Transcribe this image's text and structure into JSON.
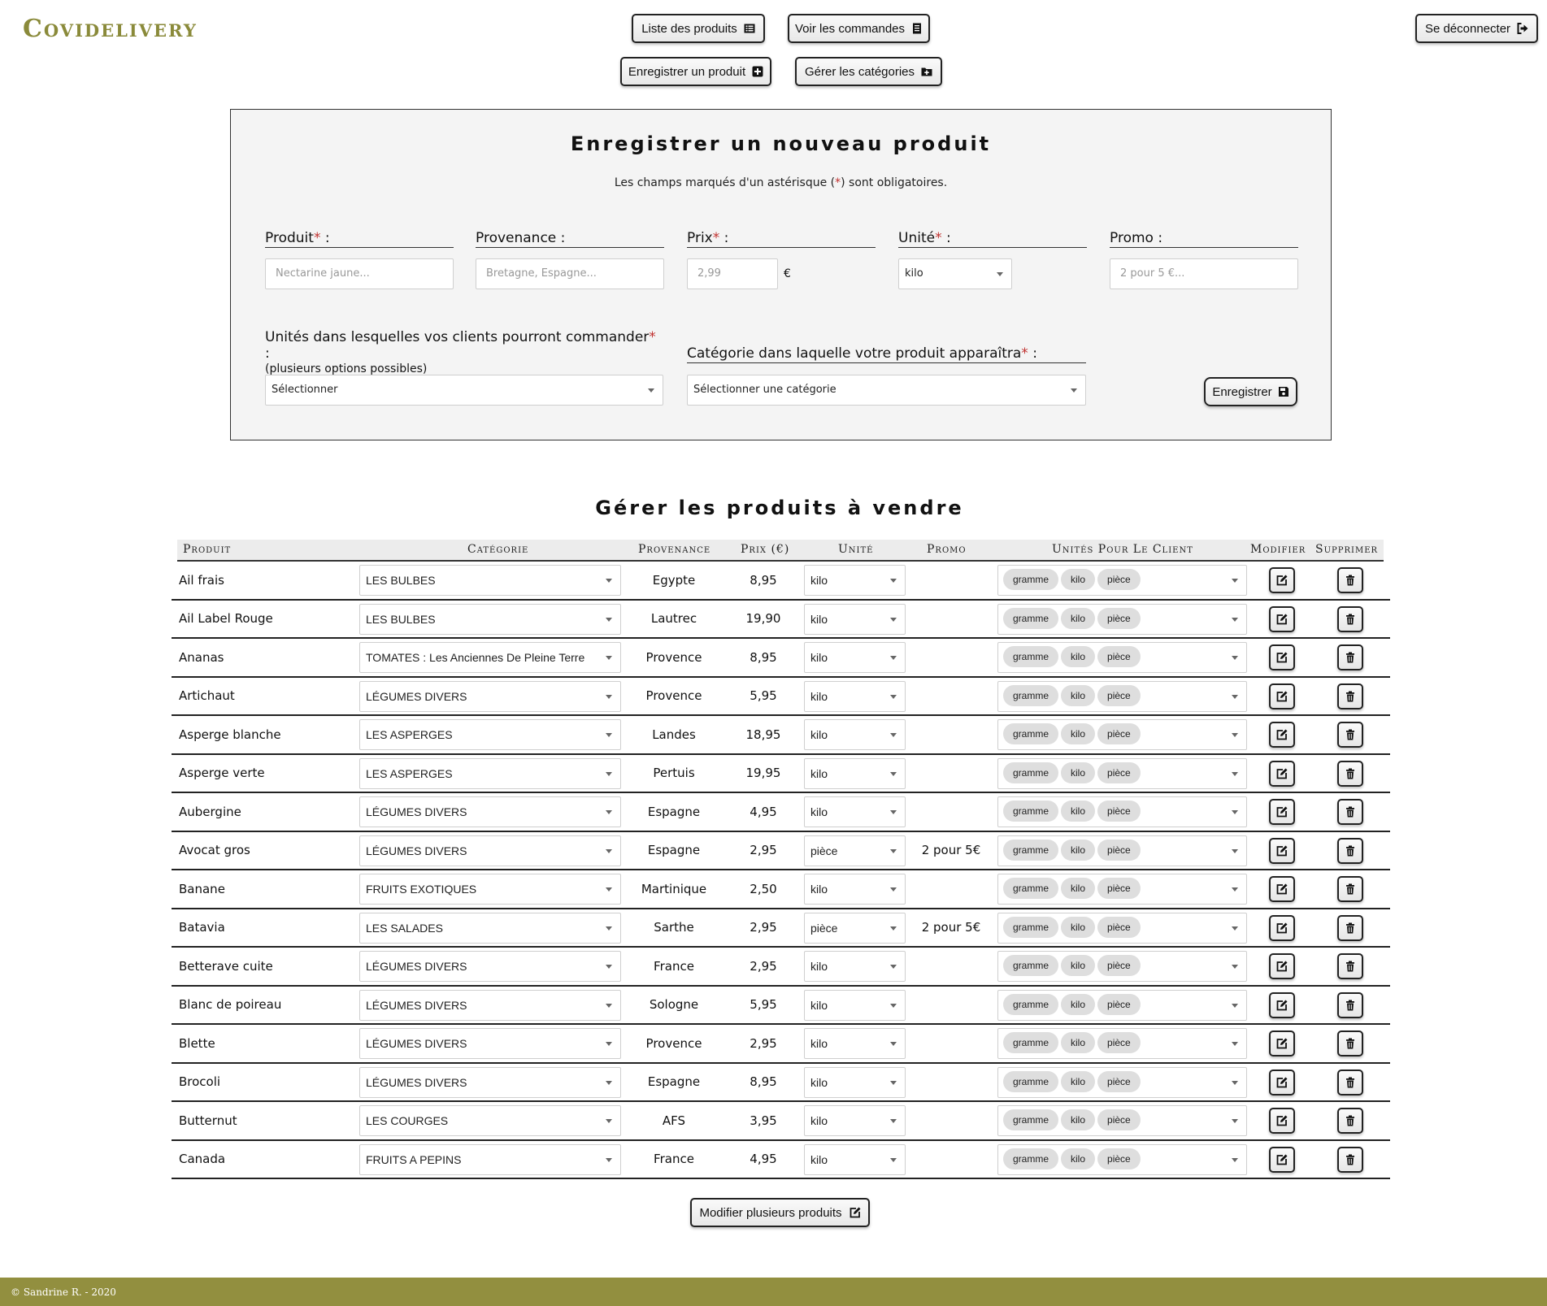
{
  "brand": {
    "name": "Covidelivery"
  },
  "nav": {
    "list_products": "Liste des produits",
    "view_orders": "Voir les commandes",
    "register_product": "Enregistrer un produit",
    "manage_categories": "Gérer les catégories",
    "logout": "Se déconnecter"
  },
  "form": {
    "title": "Enregistrer un nouveau produit",
    "note_before": "Les champs marqués d'un astérisque (",
    "note_star": "*",
    "note_after": ") sont obligatoires.",
    "fields": {
      "product": {
        "label": "Produit",
        "placeholder": "Nectarine jaune..."
      },
      "origin": {
        "label": "Provenance :",
        "placeholder": "Bretagne, Espagne..."
      },
      "price": {
        "label": "Prix",
        "placeholder": "2,99",
        "currency": "€"
      },
      "unit": {
        "label": "Unité",
        "value": "kilo"
      },
      "promo": {
        "label": "Promo :",
        "placeholder": "2 pour 5 €..."
      },
      "client_units": {
        "label": "Unités dans lesquelles vos clients pourront commander",
        "hint": "(plusieurs options possibles)",
        "value": "Sélectionner"
      },
      "category": {
        "label": "Catégorie dans laquelle votre produit apparaîtra",
        "value": "Sélectionner une catégorie"
      }
    },
    "required_mark": "*",
    "label_suffix": " :",
    "submit": "Enregistrer"
  },
  "table": {
    "title": "Gérer les produits à vendre",
    "headers": {
      "product": "Produit",
      "category": "Catégorie",
      "origin": "Provenance",
      "price": "Prix (€)",
      "unit": "Unité",
      "promo": "Promo",
      "client_units": "Unités Pour Le Client",
      "edit": "Modifier",
      "delete": "Supprimer"
    },
    "rows": [
      {
        "product": "Ail frais",
        "category": "LES BULBES",
        "origin": "Egypte",
        "price": "8,95",
        "unit": "kilo",
        "promo": "",
        "units": [
          "gramme",
          "kilo",
          "pièce"
        ]
      },
      {
        "product": "Ail Label Rouge",
        "category": "LES BULBES",
        "origin": "Lautrec",
        "price": "19,90",
        "unit": "kilo",
        "promo": "",
        "units": [
          "gramme",
          "kilo",
          "pièce"
        ]
      },
      {
        "product": "Ananas",
        "category": "TOMATES : Les Anciennes De Pleine Terre",
        "origin": "Provence",
        "price": "8,95",
        "unit": "kilo",
        "promo": "",
        "units": [
          "gramme",
          "kilo",
          "pièce"
        ]
      },
      {
        "product": "Artichaut",
        "category": "LÉGUMES DIVERS",
        "origin": "Provence",
        "price": "5,95",
        "unit": "kilo",
        "promo": "",
        "units": [
          "gramme",
          "kilo",
          "pièce"
        ]
      },
      {
        "product": "Asperge blanche",
        "category": "LES ASPERGES",
        "origin": "Landes",
        "price": "18,95",
        "unit": "kilo",
        "promo": "",
        "units": [
          "gramme",
          "kilo",
          "pièce"
        ]
      },
      {
        "product": "Asperge verte",
        "category": "LES ASPERGES",
        "origin": "Pertuis",
        "price": "19,95",
        "unit": "kilo",
        "promo": "",
        "units": [
          "gramme",
          "kilo",
          "pièce"
        ]
      },
      {
        "product": "Aubergine",
        "category": "LÉGUMES DIVERS",
        "origin": "Espagne",
        "price": "4,95",
        "unit": "kilo",
        "promo": "",
        "units": [
          "gramme",
          "kilo",
          "pièce"
        ]
      },
      {
        "product": "Avocat gros",
        "category": "LÉGUMES DIVERS",
        "origin": "Espagne",
        "price": "2,95",
        "unit": "pièce",
        "promo": "2 pour 5€",
        "units": [
          "gramme",
          "kilo",
          "pièce"
        ]
      },
      {
        "product": "Banane",
        "category": "FRUITS EXOTIQUES",
        "origin": "Martinique",
        "price": "2,50",
        "unit": "kilo",
        "promo": "",
        "units": [
          "gramme",
          "kilo",
          "pièce"
        ]
      },
      {
        "product": "Batavia",
        "category": "LES SALADES",
        "origin": "Sarthe",
        "price": "2,95",
        "unit": "pièce",
        "promo": "2 pour 5€",
        "units": [
          "gramme",
          "kilo",
          "pièce"
        ]
      },
      {
        "product": "Betterave cuite",
        "category": "LÉGUMES DIVERS",
        "origin": "France",
        "price": "2,95",
        "unit": "kilo",
        "promo": "",
        "units": [
          "gramme",
          "kilo",
          "pièce"
        ]
      },
      {
        "product": "Blanc de poireau",
        "category": "LÉGUMES DIVERS",
        "origin": "Sologne",
        "price": "5,95",
        "unit": "kilo",
        "promo": "",
        "units": [
          "gramme",
          "kilo",
          "pièce"
        ]
      },
      {
        "product": "Blette",
        "category": "LÉGUMES DIVERS",
        "origin": "Provence",
        "price": "2,95",
        "unit": "kilo",
        "promo": "",
        "units": [
          "gramme",
          "kilo",
          "pièce"
        ]
      },
      {
        "product": "Brocoli",
        "category": "LÉGUMES DIVERS",
        "origin": "Espagne",
        "price": "8,95",
        "unit": "kilo",
        "promo": "",
        "units": [
          "gramme",
          "kilo",
          "pièce"
        ]
      },
      {
        "product": "Butternut",
        "category": "LES COURGES",
        "origin": "AFS",
        "price": "3,95",
        "unit": "kilo",
        "promo": "",
        "units": [
          "gramme",
          "kilo",
          "pièce"
        ]
      },
      {
        "product": "Canada",
        "category": "FRUITS A PEPINS",
        "origin": "France",
        "price": "4,95",
        "unit": "kilo",
        "promo": "",
        "units": [
          "gramme",
          "kilo",
          "pièce"
        ]
      }
    ],
    "bulk_edit": "Modifier plusieurs produits"
  },
  "footer": {
    "text": "© Sandrine R. - 2020"
  },
  "colors": {
    "brand": "#8a8a3a",
    "footer": "#928f3f",
    "required": "#c0312f"
  },
  "icons": [
    "list-icon",
    "orders-icon",
    "plus-square-icon",
    "folder-plus-icon",
    "sign-out-icon",
    "save-icon",
    "edit-icon",
    "trash-icon"
  ]
}
